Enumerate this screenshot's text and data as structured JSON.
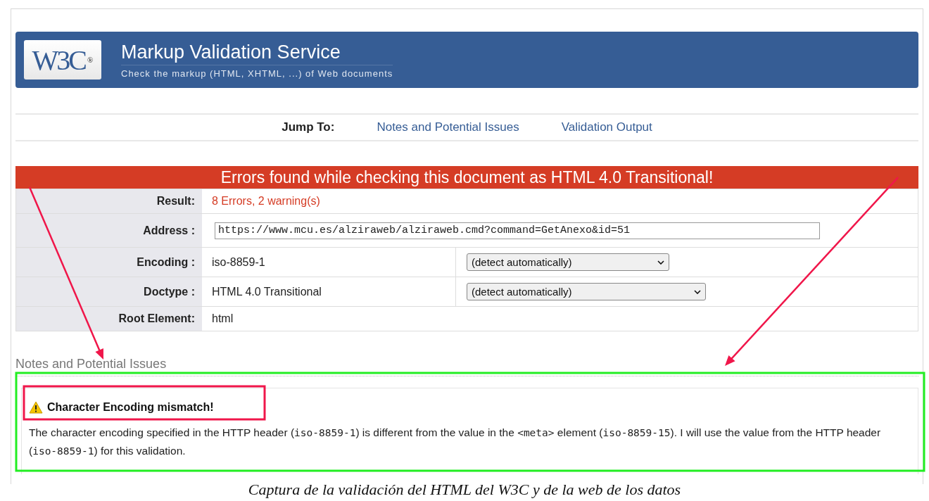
{
  "header": {
    "logo_text": "W3C",
    "logo_mark": "®",
    "title": "Markup Validation Service",
    "subtitle": "Check the markup (HTML, XHTML, ...) of Web documents"
  },
  "jump_to": {
    "label": "Jump To:",
    "links": [
      "Notes and Potential Issues",
      "Validation Output"
    ]
  },
  "banner": "Errors found while checking this document as HTML 4.0 Transitional!",
  "rows": [
    {
      "kind": "result",
      "label": "Result:",
      "value": "8 Errors, 2 warning(s)"
    },
    {
      "kind": "address",
      "label": "Address :",
      "value": "https://www.mcu.es/alziraweb/alziraweb.cmd?command=GetAnexo&id=51"
    },
    {
      "kind": "select",
      "label": "Encoding :",
      "value": "iso-8859-1",
      "select": "(detect automatically)"
    },
    {
      "kind": "select",
      "label": "Doctype :",
      "value": "HTML 4.0 Transitional",
      "select": "(detect automatically)"
    },
    {
      "kind": "text",
      "label": "Root Element:",
      "value": "html"
    }
  ],
  "notes": {
    "heading": "Notes and Potential Issues",
    "title": "Character Encoding mismatch!",
    "message": [
      {
        "kind": "text",
        "text": "The character encoding specified in the HTTP header ("
      },
      {
        "kind": "code",
        "text": "iso-8859-1"
      },
      {
        "kind": "text",
        "text": ") is different from the value in the "
      },
      {
        "kind": "code",
        "text": "<meta>"
      },
      {
        "kind": "text",
        "text": " element ("
      },
      {
        "kind": "code",
        "text": "iso-8859-15"
      },
      {
        "kind": "text",
        "text": "). I will use the value from the HTTP header ("
      },
      {
        "kind": "code",
        "text": "iso-8859-1"
      },
      {
        "kind": "text",
        "text": ") for this validation."
      }
    ]
  },
  "caption": "Captura de la validación del HTML del W3C y de la web de los datos"
}
